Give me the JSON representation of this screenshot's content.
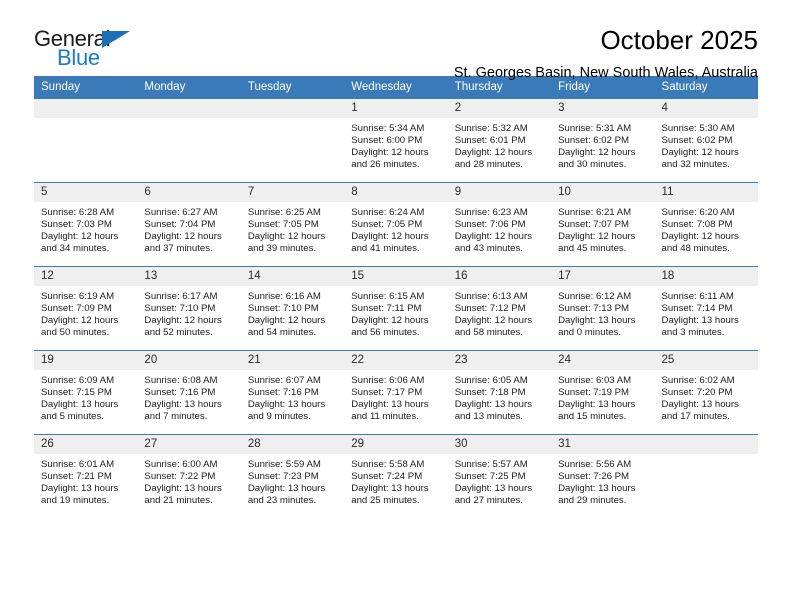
{
  "brand": {
    "name_part1": "General",
    "name_part2": "Blue",
    "accent_color": "#1b7bc4",
    "triangle_color": "#1b6fb5"
  },
  "header": {
    "month_title": "October 2025",
    "location": "St. Georges Basin, New South Wales, Australia",
    "header_bg": "#3b7ab8"
  },
  "weekday_headers": [
    "Sunday",
    "Monday",
    "Tuesday",
    "Wednesday",
    "Thursday",
    "Friday",
    "Saturday"
  ],
  "labels": {
    "sunrise": "Sunrise:",
    "sunset": "Sunset:",
    "daylight": "Daylight:"
  },
  "weeks": [
    [
      {
        "day": "",
        "sunrise": "",
        "sunset": "",
        "daylight_1": "",
        "daylight_2": "",
        "empty": true
      },
      {
        "day": "",
        "sunrise": "",
        "sunset": "",
        "daylight_1": "",
        "daylight_2": "",
        "empty": true
      },
      {
        "day": "",
        "sunrise": "",
        "sunset": "",
        "daylight_1": "",
        "daylight_2": "",
        "empty": true
      },
      {
        "day": "1",
        "sunrise": "Sunrise: 5:34 AM",
        "sunset": "Sunset: 6:00 PM",
        "daylight_1": "Daylight: 12 hours",
        "daylight_2": "and 26 minutes.",
        "empty": false
      },
      {
        "day": "2",
        "sunrise": "Sunrise: 5:32 AM",
        "sunset": "Sunset: 6:01 PM",
        "daylight_1": "Daylight: 12 hours",
        "daylight_2": "and 28 minutes.",
        "empty": false
      },
      {
        "day": "3",
        "sunrise": "Sunrise: 5:31 AM",
        "sunset": "Sunset: 6:02 PM",
        "daylight_1": "Daylight: 12 hours",
        "daylight_2": "and 30 minutes.",
        "empty": false
      },
      {
        "day": "4",
        "sunrise": "Sunrise: 5:30 AM",
        "sunset": "Sunset: 6:02 PM",
        "daylight_1": "Daylight: 12 hours",
        "daylight_2": "and 32 minutes.",
        "empty": false
      }
    ],
    [
      {
        "day": "5",
        "sunrise": "Sunrise: 6:28 AM",
        "sunset": "Sunset: 7:03 PM",
        "daylight_1": "Daylight: 12 hours",
        "daylight_2": "and 34 minutes.",
        "empty": false
      },
      {
        "day": "6",
        "sunrise": "Sunrise: 6:27 AM",
        "sunset": "Sunset: 7:04 PM",
        "daylight_1": "Daylight: 12 hours",
        "daylight_2": "and 37 minutes.",
        "empty": false
      },
      {
        "day": "7",
        "sunrise": "Sunrise: 6:25 AM",
        "sunset": "Sunset: 7:05 PM",
        "daylight_1": "Daylight: 12 hours",
        "daylight_2": "and 39 minutes.",
        "empty": false
      },
      {
        "day": "8",
        "sunrise": "Sunrise: 6:24 AM",
        "sunset": "Sunset: 7:05 PM",
        "daylight_1": "Daylight: 12 hours",
        "daylight_2": "and 41 minutes.",
        "empty": false
      },
      {
        "day": "9",
        "sunrise": "Sunrise: 6:23 AM",
        "sunset": "Sunset: 7:06 PM",
        "daylight_1": "Daylight: 12 hours",
        "daylight_2": "and 43 minutes.",
        "empty": false
      },
      {
        "day": "10",
        "sunrise": "Sunrise: 6:21 AM",
        "sunset": "Sunset: 7:07 PM",
        "daylight_1": "Daylight: 12 hours",
        "daylight_2": "and 45 minutes.",
        "empty": false
      },
      {
        "day": "11",
        "sunrise": "Sunrise: 6:20 AM",
        "sunset": "Sunset: 7:08 PM",
        "daylight_1": "Daylight: 12 hours",
        "daylight_2": "and 48 minutes.",
        "empty": false
      }
    ],
    [
      {
        "day": "12",
        "sunrise": "Sunrise: 6:19 AM",
        "sunset": "Sunset: 7:09 PM",
        "daylight_1": "Daylight: 12 hours",
        "daylight_2": "and 50 minutes.",
        "empty": false
      },
      {
        "day": "13",
        "sunrise": "Sunrise: 6:17 AM",
        "sunset": "Sunset: 7:10 PM",
        "daylight_1": "Daylight: 12 hours",
        "daylight_2": "and 52 minutes.",
        "empty": false
      },
      {
        "day": "14",
        "sunrise": "Sunrise: 6:16 AM",
        "sunset": "Sunset: 7:10 PM",
        "daylight_1": "Daylight: 12 hours",
        "daylight_2": "and 54 minutes.",
        "empty": false
      },
      {
        "day": "15",
        "sunrise": "Sunrise: 6:15 AM",
        "sunset": "Sunset: 7:11 PM",
        "daylight_1": "Daylight: 12 hours",
        "daylight_2": "and 56 minutes.",
        "empty": false
      },
      {
        "day": "16",
        "sunrise": "Sunrise: 6:13 AM",
        "sunset": "Sunset: 7:12 PM",
        "daylight_1": "Daylight: 12 hours",
        "daylight_2": "and 58 minutes.",
        "empty": false
      },
      {
        "day": "17",
        "sunrise": "Sunrise: 6:12 AM",
        "sunset": "Sunset: 7:13 PM",
        "daylight_1": "Daylight: 13 hours",
        "daylight_2": "and 0 minutes.",
        "empty": false
      },
      {
        "day": "18",
        "sunrise": "Sunrise: 6:11 AM",
        "sunset": "Sunset: 7:14 PM",
        "daylight_1": "Daylight: 13 hours",
        "daylight_2": "and 3 minutes.",
        "empty": false
      }
    ],
    [
      {
        "day": "19",
        "sunrise": "Sunrise: 6:09 AM",
        "sunset": "Sunset: 7:15 PM",
        "daylight_1": "Daylight: 13 hours",
        "daylight_2": "and 5 minutes.",
        "empty": false
      },
      {
        "day": "20",
        "sunrise": "Sunrise: 6:08 AM",
        "sunset": "Sunset: 7:16 PM",
        "daylight_1": "Daylight: 13 hours",
        "daylight_2": "and 7 minutes.",
        "empty": false
      },
      {
        "day": "21",
        "sunrise": "Sunrise: 6:07 AM",
        "sunset": "Sunset: 7:16 PM",
        "daylight_1": "Daylight: 13 hours",
        "daylight_2": "and 9 minutes.",
        "empty": false
      },
      {
        "day": "22",
        "sunrise": "Sunrise: 6:06 AM",
        "sunset": "Sunset: 7:17 PM",
        "daylight_1": "Daylight: 13 hours",
        "daylight_2": "and 11 minutes.",
        "empty": false
      },
      {
        "day": "23",
        "sunrise": "Sunrise: 6:05 AM",
        "sunset": "Sunset: 7:18 PM",
        "daylight_1": "Daylight: 13 hours",
        "daylight_2": "and 13 minutes.",
        "empty": false
      },
      {
        "day": "24",
        "sunrise": "Sunrise: 6:03 AM",
        "sunset": "Sunset: 7:19 PM",
        "daylight_1": "Daylight: 13 hours",
        "daylight_2": "and 15 minutes.",
        "empty": false
      },
      {
        "day": "25",
        "sunrise": "Sunrise: 6:02 AM",
        "sunset": "Sunset: 7:20 PM",
        "daylight_1": "Daylight: 13 hours",
        "daylight_2": "and 17 minutes.",
        "empty": false
      }
    ],
    [
      {
        "day": "26",
        "sunrise": "Sunrise: 6:01 AM",
        "sunset": "Sunset: 7:21 PM",
        "daylight_1": "Daylight: 13 hours",
        "daylight_2": "and 19 minutes.",
        "empty": false
      },
      {
        "day": "27",
        "sunrise": "Sunrise: 6:00 AM",
        "sunset": "Sunset: 7:22 PM",
        "daylight_1": "Daylight: 13 hours",
        "daylight_2": "and 21 minutes.",
        "empty": false
      },
      {
        "day": "28",
        "sunrise": "Sunrise: 5:59 AM",
        "sunset": "Sunset: 7:23 PM",
        "daylight_1": "Daylight: 13 hours",
        "daylight_2": "and 23 minutes.",
        "empty": false
      },
      {
        "day": "29",
        "sunrise": "Sunrise: 5:58 AM",
        "sunset": "Sunset: 7:24 PM",
        "daylight_1": "Daylight: 13 hours",
        "daylight_2": "and 25 minutes.",
        "empty": false
      },
      {
        "day": "30",
        "sunrise": "Sunrise: 5:57 AM",
        "sunset": "Sunset: 7:25 PM",
        "daylight_1": "Daylight: 13 hours",
        "daylight_2": "and 27 minutes.",
        "empty": false
      },
      {
        "day": "31",
        "sunrise": "Sunrise: 5:56 AM",
        "sunset": "Sunset: 7:26 PM",
        "daylight_1": "Daylight: 13 hours",
        "daylight_2": "and 29 minutes.",
        "empty": false
      },
      {
        "day": "",
        "sunrise": "",
        "sunset": "",
        "daylight_1": "",
        "daylight_2": "",
        "empty": true
      }
    ]
  ]
}
